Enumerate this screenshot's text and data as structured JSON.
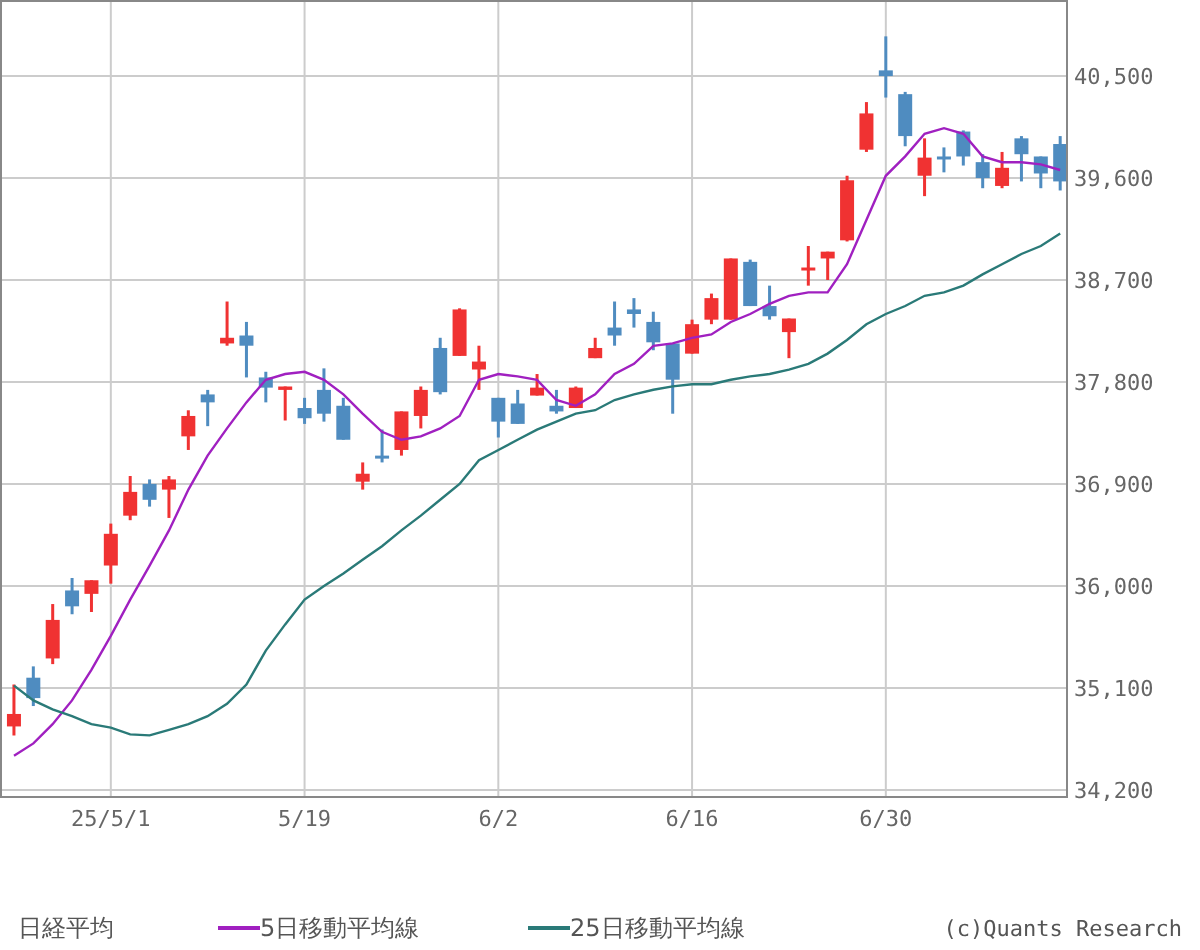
{
  "chart": {
    "chart_data": {
      "type": "candlestick",
      "grid": true,
      "categories": [
        null,
        null,
        null,
        null,
        null,
        "25/5/1",
        null,
        null,
        null,
        null,
        null,
        null,
        null,
        null,
        null,
        "5/19",
        null,
        null,
        null,
        null,
        null,
        null,
        null,
        null,
        null,
        "6/2",
        null,
        null,
        null,
        null,
        null,
        null,
        null,
        null,
        null,
        "6/16",
        null,
        null,
        null,
        null,
        null,
        null,
        null,
        null,
        null,
        "6/30",
        null,
        null,
        null,
        null,
        null,
        null,
        null,
        null,
        null
      ],
      "ylim": [
        34146,
        41171
      ],
      "yticks": [
        {
          "value": 34200,
          "label": "34,200"
        },
        {
          "value": 35100,
          "label": "35,100"
        },
        {
          "value": 36000,
          "label": "36,000"
        },
        {
          "value": 36900,
          "label": "36,900"
        },
        {
          "value": 37800,
          "label": "37,800"
        },
        {
          "value": 38700,
          "label": "38,700"
        },
        {
          "value": 39600,
          "label": "39,600"
        },
        {
          "value": 40500,
          "label": "40,500"
        }
      ],
      "ohlc": [
        [
          34760,
          35130,
          34680,
          34870
        ],
        [
          35190,
          35290,
          34940,
          35010
        ],
        [
          35360,
          35840,
          35310,
          35700
        ],
        [
          35960,
          36070,
          35750,
          35820
        ],
        [
          35930,
          36050,
          35770,
          36050
        ],
        [
          36180,
          36550,
          36020,
          36460
        ],
        [
          36620,
          36970,
          36580,
          36830
        ],
        [
          36900,
          36940,
          36700,
          36760
        ],
        [
          36850,
          36970,
          36600,
          36940
        ],
        [
          37320,
          37550,
          37200,
          37500
        ],
        [
          37690,
          37730,
          37410,
          37620
        ],
        [
          38140,
          38510,
          38120,
          38190
        ],
        [
          38210,
          38330,
          37840,
          38120
        ],
        [
          37840,
          37890,
          37620,
          37750
        ],
        [
          37730,
          37760,
          37460,
          37760
        ],
        [
          37570,
          37660,
          37430,
          37480
        ],
        [
          37730,
          37920,
          37450,
          37520
        ],
        [
          37590,
          37660,
          37290,
          37290
        ],
        [
          36920,
          37090,
          36850,
          36990
        ],
        [
          37150,
          37380,
          37090,
          37130
        ],
        [
          37200,
          37540,
          37150,
          37540
        ],
        [
          37500,
          37760,
          37390,
          37730
        ],
        [
          38100,
          38190,
          37690,
          37710
        ],
        [
          38030,
          38450,
          38030,
          38440
        ],
        [
          37910,
          38120,
          37730,
          37980
        ],
        [
          37660,
          37660,
          37310,
          37450
        ],
        [
          37610,
          37730,
          37430,
          37430
        ],
        [
          37680,
          37870,
          37680,
          37750
        ],
        [
          37590,
          37730,
          37520,
          37540
        ],
        [
          37570,
          37760,
          37570,
          37750
        ],
        [
          38010,
          38190,
          38010,
          38100
        ],
        [
          38280,
          38510,
          38120,
          38210
        ],
        [
          38440,
          38540,
          38280,
          38400
        ],
        [
          38330,
          38420,
          38080,
          38150
        ],
        [
          38140,
          38140,
          37520,
          37820
        ],
        [
          38050,
          38350,
          38050,
          38310
        ],
        [
          38350,
          38580,
          38310,
          38540
        ],
        [
          38350,
          38890,
          38350,
          38890
        ],
        [
          38860,
          38880,
          38470,
          38470
        ],
        [
          38470,
          38650,
          38350,
          38380
        ],
        [
          38240,
          38360,
          38010,
          38360
        ],
        [
          38790,
          39000,
          38650,
          38810
        ],
        [
          38890,
          38950,
          38700,
          38950
        ],
        [
          39050,
          39620,
          39040,
          39580
        ],
        [
          39850,
          40270,
          39830,
          40170
        ],
        [
          40550,
          40850,
          40310,
          40500
        ],
        [
          40340,
          40360,
          39880,
          39970
        ],
        [
          39620,
          39950,
          39440,
          39780
        ],
        [
          39790,
          39870,
          39650,
          39770
        ],
        [
          40010,
          40020,
          39710,
          39790
        ],
        [
          39740,
          39810,
          39510,
          39600
        ],
        [
          39530,
          39830,
          39510,
          39690
        ],
        [
          39950,
          39970,
          39570,
          39810
        ],
        [
          39790,
          39790,
          39510,
          39640
        ],
        [
          39900,
          39970,
          39490,
          39570
        ]
      ],
      "series": [
        {
          "name": "5日移動平均線",
          "type": "line",
          "color": "#a020c0",
          "values": [
            34500,
            34610,
            34780,
            34990,
            35260,
            35560,
            35880,
            36180,
            36490,
            36850,
            37150,
            37390,
            37620,
            37820,
            37870,
            37890,
            37820,
            37690,
            37520,
            37360,
            37290,
            37320,
            37390,
            37500,
            37820,
            37870,
            37850,
            37820,
            37640,
            37590,
            37690,
            37870,
            37960,
            38120,
            38140,
            38190,
            38220,
            38330,
            38400,
            38490,
            38560,
            38590,
            38590,
            38840,
            39230,
            39620,
            39790,
            39990,
            40040,
            39990,
            39790,
            39740,
            39740,
            39720,
            39670
          ]
        },
        {
          "name": "25日移動平均線",
          "type": "line",
          "color": "#2a7a78",
          "values": [
            35120,
            34990,
            34910,
            34850,
            34780,
            34750,
            34690,
            34680,
            34730,
            34780,
            34850,
            34960,
            35130,
            35430,
            35660,
            35880,
            36000,
            36110,
            36230,
            36350,
            36490,
            36620,
            36760,
            36900,
            37110,
            37200,
            37290,
            37380,
            37450,
            37520,
            37550,
            37640,
            37690,
            37730,
            37760,
            37780,
            37780,
            37820,
            37850,
            37870,
            37910,
            37960,
            38050,
            38170,
            38310,
            38400,
            38470,
            38560,
            38590,
            38650,
            38750,
            38840,
            38930,
            39000,
            39110
          ]
        }
      ]
    },
    "candle_label": "日経平均",
    "credit": "(c)Quants Research"
  }
}
